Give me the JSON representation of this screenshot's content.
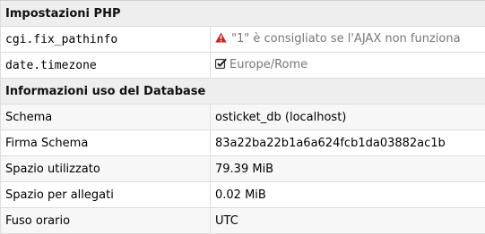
{
  "php_section": {
    "title": "Impostazioni PHP",
    "rows": [
      {
        "name": "cgi.fix_pathinfo",
        "value": "\"1\" è consigliato se l'AJAX non funziona",
        "icon": "warning-icon"
      },
      {
        "name": "date.timezone",
        "value": "Europe/Rome",
        "icon": "checkbox-checked-icon"
      }
    ]
  },
  "db_section": {
    "title": "Informazioni uso del Database",
    "rows": [
      {
        "name": "Schema",
        "value": "osticket_db (localhost)"
      },
      {
        "name": "Firma Schema",
        "value": "83a22ba22b1a6a624fcb1da03882ac1b"
      },
      {
        "name": "Spazio utilizzato",
        "value": "79.39 MiB"
      },
      {
        "name": "Spazio per allegati",
        "value": "0.02 MiB"
      },
      {
        "name": "Fuso orario",
        "value": "UTC"
      }
    ]
  },
  "colors": {
    "warning": "#cc2222",
    "section_bg": "#eeeeee",
    "alt_row_bg": "#f7f7f7",
    "muted_text": "#777777"
  }
}
